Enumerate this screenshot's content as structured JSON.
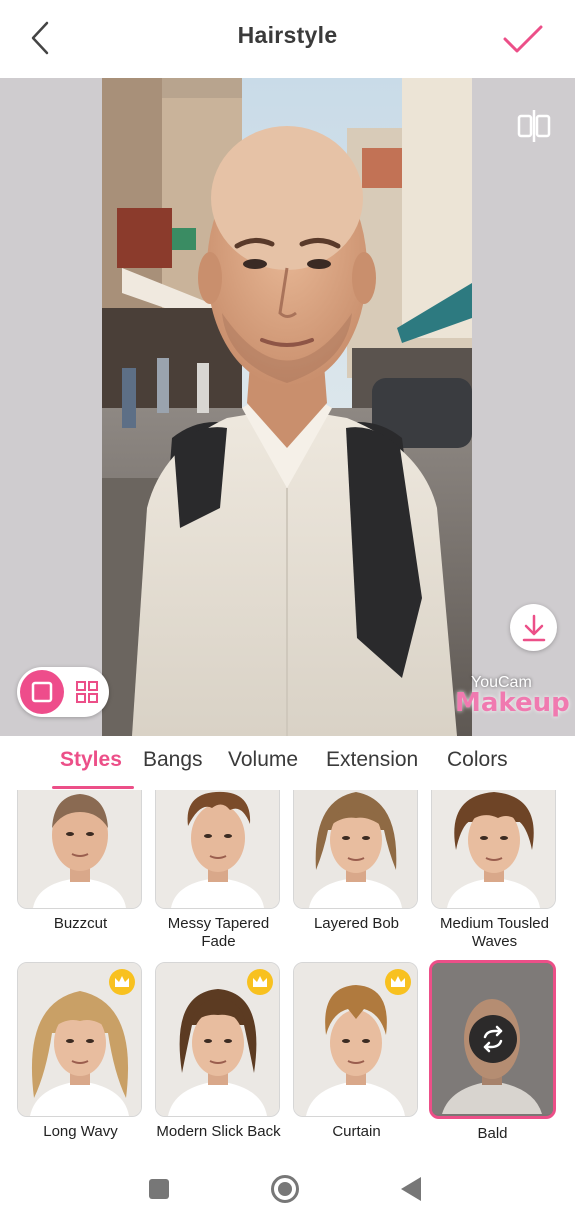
{
  "header": {
    "title": "Hairstyle",
    "back_icon": "chevron-left-icon",
    "apply_icon": "checkmark-icon"
  },
  "preview": {
    "compare_icon": "compare-split-icon",
    "download_icon": "download-icon",
    "view_modes": [
      "single-view-icon",
      "grid-view-icon"
    ],
    "selected_view": "single",
    "watermark": {
      "line1": "YouCam",
      "line2": "Makeup"
    }
  },
  "tabs": [
    {
      "label": "Styles",
      "active": true
    },
    {
      "label": "Bangs",
      "active": false
    },
    {
      "label": "Volume",
      "active": false
    },
    {
      "label": "Extension",
      "active": false
    },
    {
      "label": "Colors",
      "active": false
    }
  ],
  "styles": [
    {
      "label": "Buzzcut",
      "premium": false,
      "selected": false
    },
    {
      "label": "Messy Tapered Fade",
      "premium": false,
      "selected": false
    },
    {
      "label": "Layered Bob",
      "premium": false,
      "selected": false
    },
    {
      "label": "Medium Tousled Waves",
      "premium": false,
      "selected": false
    },
    {
      "label": "Long Wavy",
      "premium": true,
      "selected": false
    },
    {
      "label": "Modern Slick Back",
      "premium": true,
      "selected": false
    },
    {
      "label": "Curtain",
      "premium": true,
      "selected": false
    },
    {
      "label": "Bald",
      "premium": false,
      "selected": true
    }
  ],
  "navbar": {
    "icons": [
      "recents-square-icon",
      "home-circle-icon",
      "back-triangle-icon"
    ]
  },
  "colors": {
    "accent": "#ec4f88",
    "crown": "#f8c11f",
    "preview_bg": "#cfcccf"
  }
}
